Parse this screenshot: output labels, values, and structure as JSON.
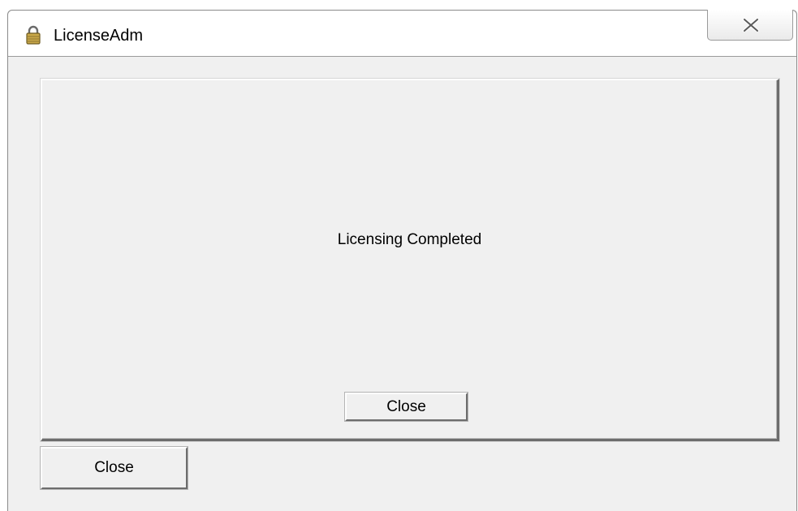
{
  "window": {
    "title": "LicenseAdm",
    "title_icon": "lock-icon",
    "close_icon": "close-x-icon"
  },
  "panel": {
    "message": "Licensing Completed",
    "close_label": "Close"
  },
  "footer": {
    "close_label": "Close"
  }
}
